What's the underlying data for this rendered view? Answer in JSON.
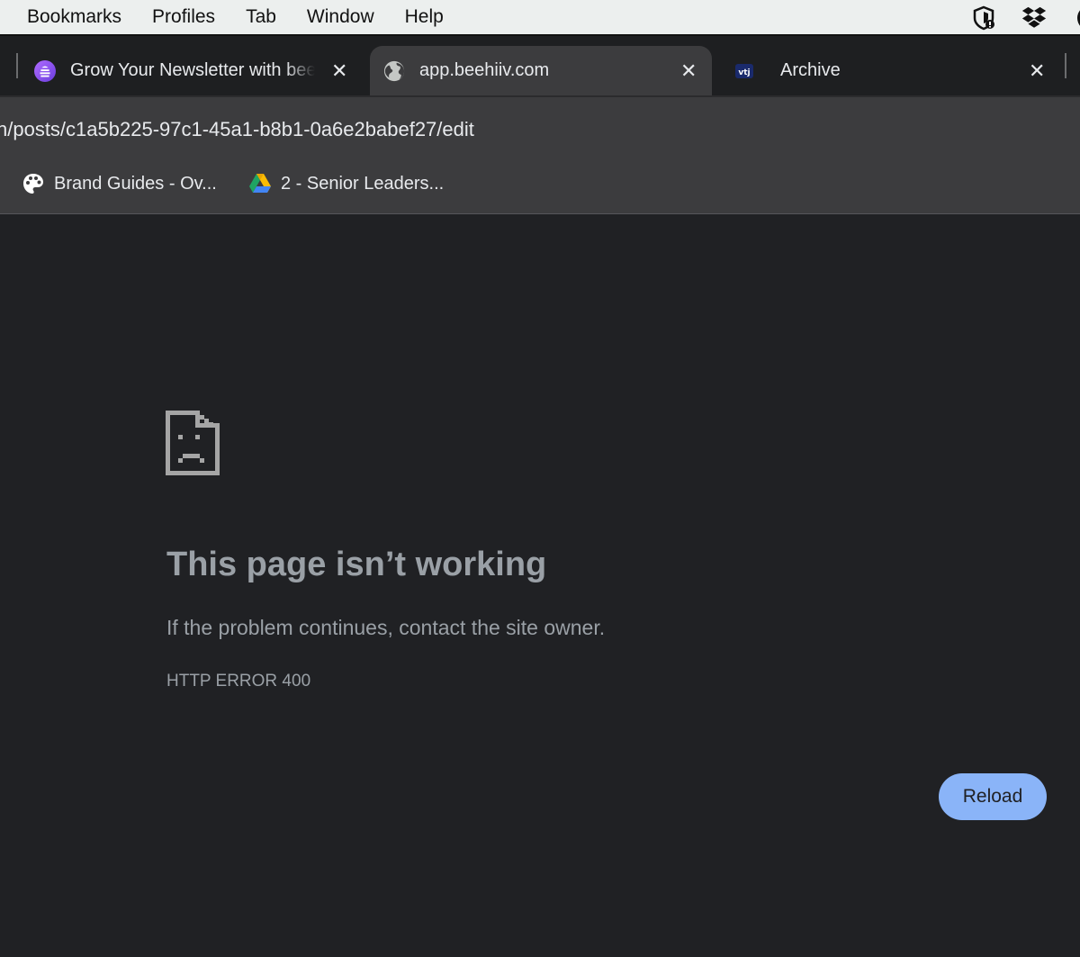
{
  "menubar": {
    "items": [
      "Bookmarks",
      "Profiles",
      "Tab",
      "Window",
      "Help"
    ],
    "tray_icons": [
      "privacy-shield-icon",
      "dropbox-icon",
      "grammarly-icon"
    ]
  },
  "tabs": [
    {
      "title": "Grow Your Newsletter with beehiiv",
      "favicon": "beehiiv-icon",
      "active": false
    },
    {
      "title": "app.beehiiv.com",
      "favicon": "globe-icon",
      "active": true
    },
    {
      "title": "Archive",
      "favicon": "vtj-icon",
      "active": false
    }
  ],
  "close_glyph": "✕",
  "address": {
    "url": "n/posts/c1a5b225-97c1-45a1-b8b1-0a6e2babef27/edit"
  },
  "bookmarks": [
    {
      "label": "Brand Guides - Ov...",
      "icon": "palette-icon"
    },
    {
      "label": "2 - Senior Leaders...",
      "icon": "google-drive-icon"
    }
  ],
  "error": {
    "title": "This page isn’t working",
    "message": "If the problem continues, contact the site owner.",
    "code": "HTTP ERROR 400",
    "reload_label": "Reload"
  },
  "colors": {
    "page_bg": "#202124",
    "toolbar_bg": "#3c3c3e",
    "text_muted": "#9aa0a6",
    "button_bg": "#8ab4f8"
  }
}
